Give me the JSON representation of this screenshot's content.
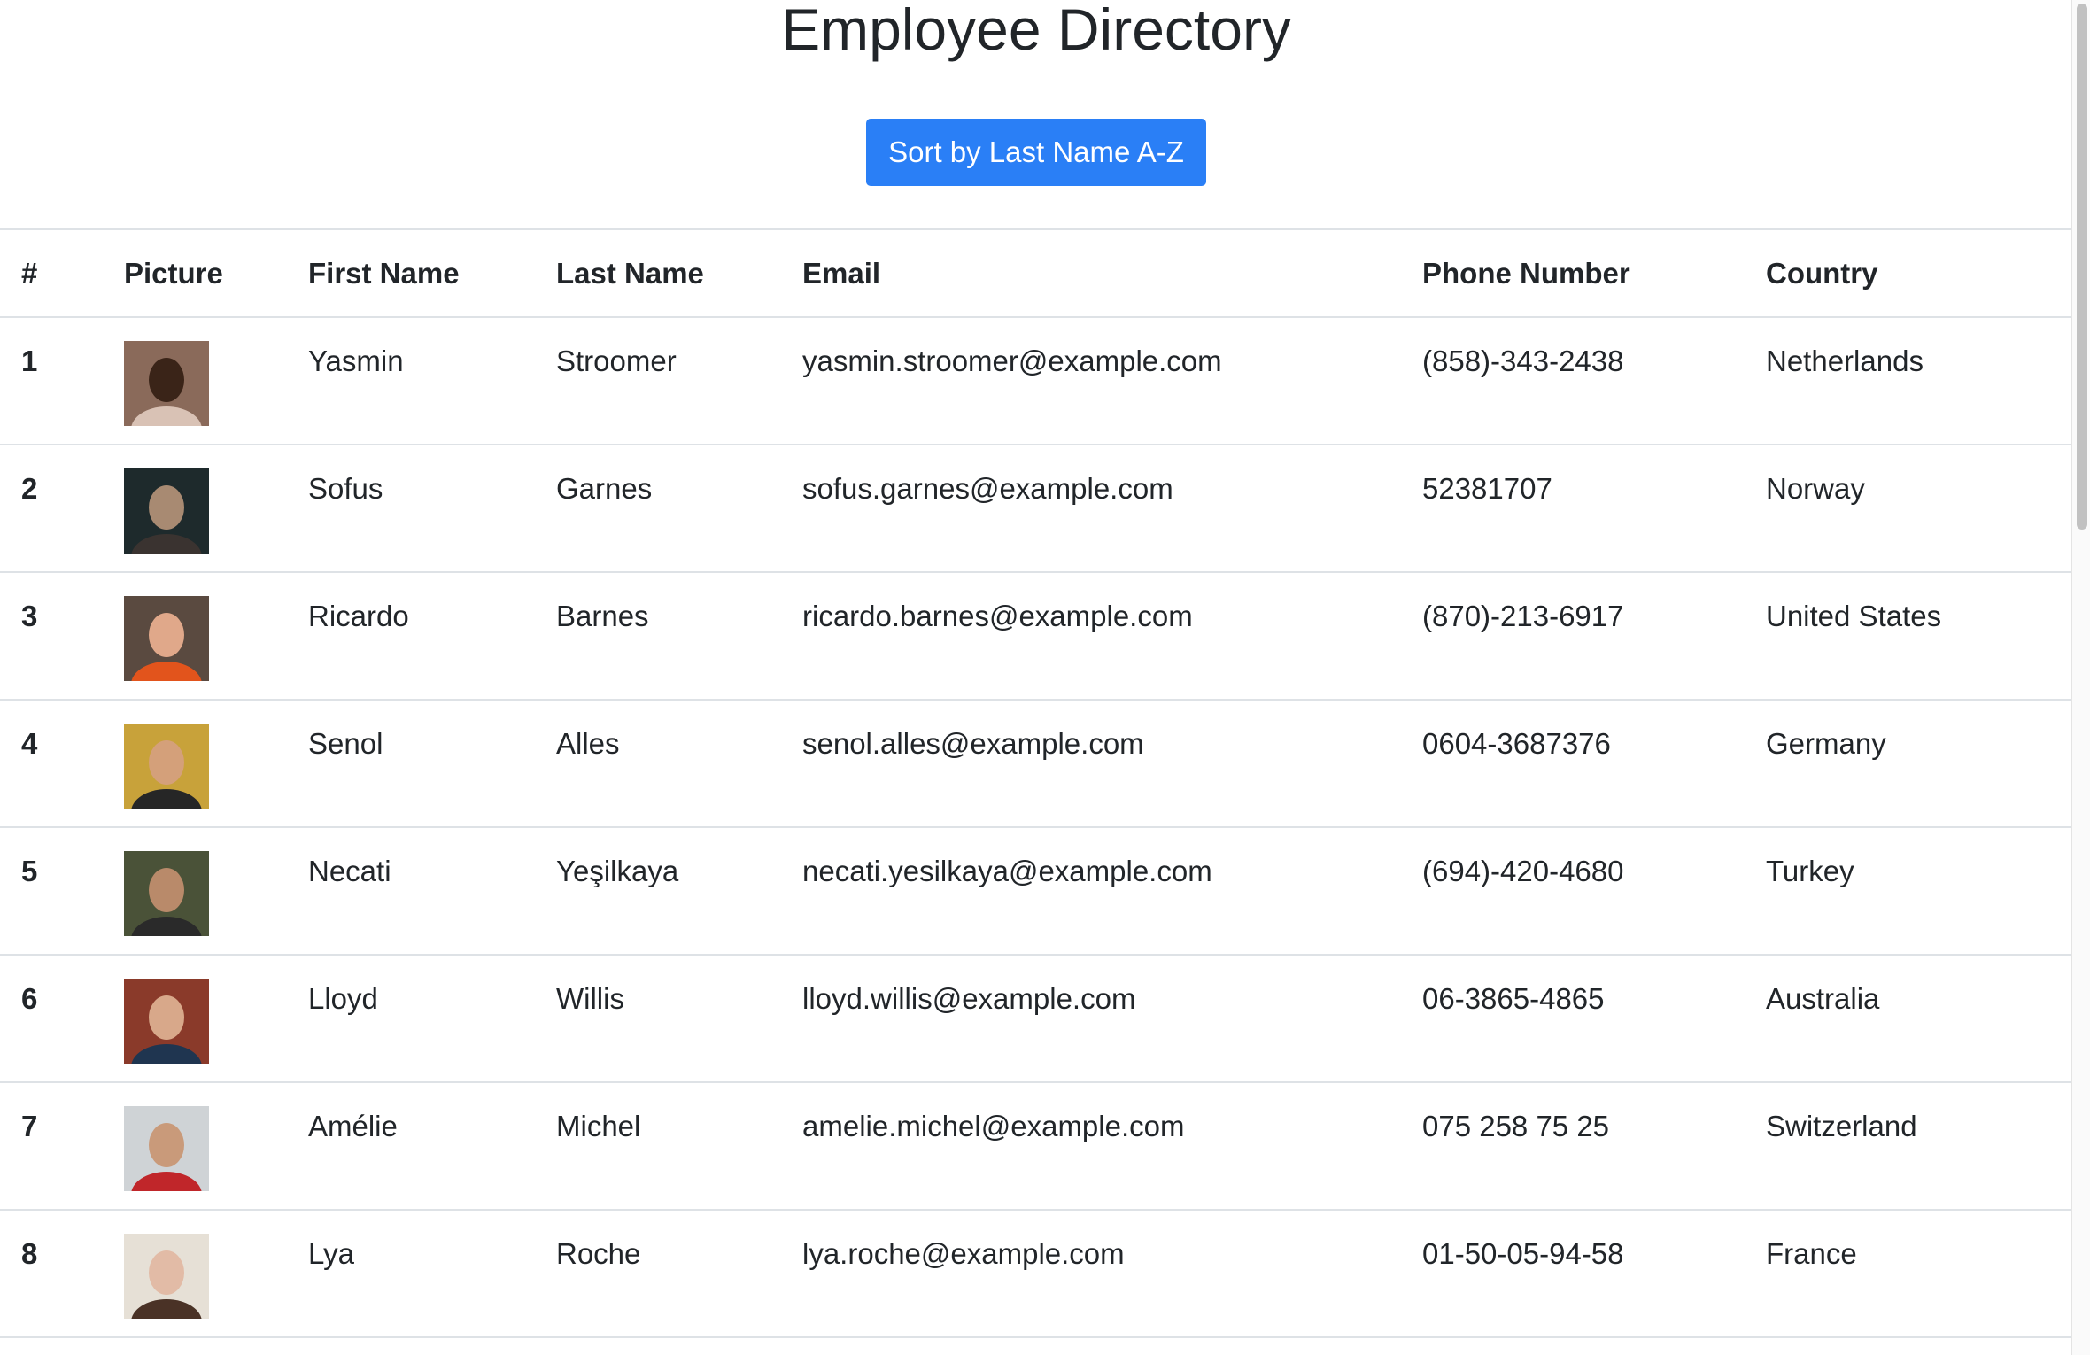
{
  "page": {
    "title": "Employee Directory",
    "sort_button_label": "Sort by Last Name A-Z",
    "accent_color": "#2a7ff6"
  },
  "table": {
    "headers": [
      "#",
      "Picture",
      "First Name",
      "Last Name",
      "Email",
      "Phone Number",
      "Country"
    ],
    "rows": [
      {
        "num": "1",
        "first": "Yasmin",
        "last": "Stroomer",
        "email": "yasmin.stroomer@example.com",
        "phone": "(858)-343-2438",
        "country": "Netherlands",
        "avatar_colors": [
          "#8a6a5a",
          "#3a2418",
          "#d9c2b5"
        ]
      },
      {
        "num": "2",
        "first": "Sofus",
        "last": "Garnes",
        "email": "sofus.garnes@example.com",
        "phone": "52381707",
        "country": "Norway",
        "avatar_colors": [
          "#1e2a2c",
          "#a88a72",
          "#3a3330"
        ]
      },
      {
        "num": "3",
        "first": "Ricardo",
        "last": "Barnes",
        "email": "ricardo.barnes@example.com",
        "phone": "(870)-213-6917",
        "country": "United States",
        "avatar_colors": [
          "#5a4a40",
          "#e0a88a",
          "#e2541c"
        ]
      },
      {
        "num": "4",
        "first": "Senol",
        "last": "Alles",
        "email": "senol.alles@example.com",
        "phone": "0604-3687376",
        "country": "Germany",
        "avatar_colors": [
          "#c8a23a",
          "#d4a07a",
          "#262626"
        ]
      },
      {
        "num": "5",
        "first": "Necati",
        "last": "Yeşilkaya",
        "email": "necati.yesilkaya@example.com",
        "phone": "(694)-420-4680",
        "country": "Turkey",
        "avatar_colors": [
          "#4a5238",
          "#b98a6a",
          "#2a2a2a"
        ]
      },
      {
        "num": "6",
        "first": "Lloyd",
        "last": "Willis",
        "email": "lloyd.willis@example.com",
        "phone": "06-3865-4865",
        "country": "Australia",
        "avatar_colors": [
          "#8a3a2a",
          "#d8a88a",
          "#1f3550"
        ]
      },
      {
        "num": "7",
        "first": "Amélie",
        "last": "Michel",
        "email": "amelie.michel@example.com",
        "phone": "075 258 75 25",
        "country": "Switzerland",
        "avatar_colors": [
          "#cfd3d6",
          "#c99a7a",
          "#c0262a"
        ]
      },
      {
        "num": "8",
        "first": "Lya",
        "last": "Roche",
        "email": "lya.roche@example.com",
        "phone": "01-50-05-94-58",
        "country": "France",
        "avatar_colors": [
          "#e6e0d6",
          "#e2bba6",
          "#4a3226"
        ]
      }
    ]
  }
}
